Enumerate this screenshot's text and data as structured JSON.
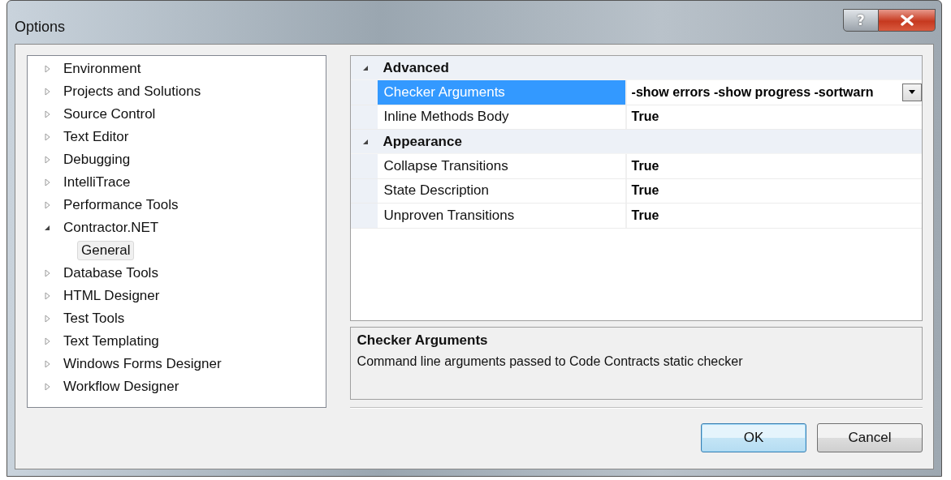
{
  "window": {
    "title": "Options",
    "help_button": "?"
  },
  "tree": [
    {
      "label": "Environment",
      "expanded": false,
      "selected": false
    },
    {
      "label": "Projects and Solutions",
      "expanded": false,
      "selected": false
    },
    {
      "label": "Source Control",
      "expanded": false,
      "selected": false
    },
    {
      "label": "Text Editor",
      "expanded": false,
      "selected": false
    },
    {
      "label": "Debugging",
      "expanded": false,
      "selected": false
    },
    {
      "label": "IntelliTrace",
      "expanded": false,
      "selected": false
    },
    {
      "label": "Performance Tools",
      "expanded": false,
      "selected": false
    },
    {
      "label": "Contractor.NET",
      "expanded": true,
      "selected": false,
      "children": [
        {
          "label": "General",
          "selected": true
        }
      ]
    },
    {
      "label": "Database Tools",
      "expanded": false,
      "selected": false
    },
    {
      "label": "HTML Designer",
      "expanded": false,
      "selected": false
    },
    {
      "label": "Test Tools",
      "expanded": false,
      "selected": false
    },
    {
      "label": "Text Templating",
      "expanded": false,
      "selected": false
    },
    {
      "label": "Windows Forms Designer",
      "expanded": false,
      "selected": false
    },
    {
      "label": "Workflow Designer",
      "expanded": false,
      "selected": false
    }
  ],
  "properties": [
    {
      "category": "Advanced",
      "expanded": true,
      "items": [
        {
          "name": "Checker Arguments",
          "value": "-show errors -show progress -sortwarn",
          "selected": true
        },
        {
          "name": "Inline Methods Body",
          "value": "True",
          "selected": false
        }
      ]
    },
    {
      "category": "Appearance",
      "expanded": true,
      "items": [
        {
          "name": "Collapse Transitions",
          "value": "True",
          "selected": false
        },
        {
          "name": "State Description",
          "value": "True",
          "selected": false
        },
        {
          "name": "Unproven Transitions",
          "value": "True",
          "selected": false
        }
      ]
    }
  ],
  "description": {
    "title": "Checker Arguments",
    "text": "Command line arguments passed to Code Contracts static checker"
  },
  "buttons": [
    {
      "label": "OK",
      "default": true
    },
    {
      "label": "Cancel",
      "default": false
    }
  ]
}
